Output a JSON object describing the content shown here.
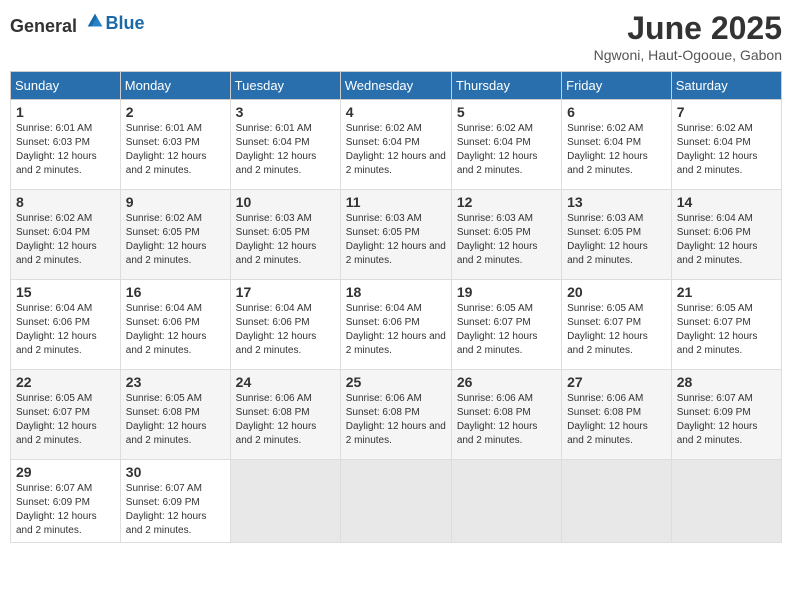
{
  "logo": {
    "general": "General",
    "blue": "Blue"
  },
  "title": "June 2025",
  "location": "Ngwoni, Haut-Ogooue, Gabon",
  "headers": [
    "Sunday",
    "Monday",
    "Tuesday",
    "Wednesday",
    "Thursday",
    "Friday",
    "Saturday"
  ],
  "weeks": [
    [
      {
        "day": "1",
        "sunrise": "6:01 AM",
        "sunset": "6:03 PM",
        "daylight": "12 hours and 2 minutes."
      },
      {
        "day": "2",
        "sunrise": "6:01 AM",
        "sunset": "6:03 PM",
        "daylight": "12 hours and 2 minutes."
      },
      {
        "day": "3",
        "sunrise": "6:01 AM",
        "sunset": "6:04 PM",
        "daylight": "12 hours and 2 minutes."
      },
      {
        "day": "4",
        "sunrise": "6:02 AM",
        "sunset": "6:04 PM",
        "daylight": "12 hours and 2 minutes."
      },
      {
        "day": "5",
        "sunrise": "6:02 AM",
        "sunset": "6:04 PM",
        "daylight": "12 hours and 2 minutes."
      },
      {
        "day": "6",
        "sunrise": "6:02 AM",
        "sunset": "6:04 PM",
        "daylight": "12 hours and 2 minutes."
      },
      {
        "day": "7",
        "sunrise": "6:02 AM",
        "sunset": "6:04 PM",
        "daylight": "12 hours and 2 minutes."
      }
    ],
    [
      {
        "day": "8",
        "sunrise": "6:02 AM",
        "sunset": "6:04 PM",
        "daylight": "12 hours and 2 minutes."
      },
      {
        "day": "9",
        "sunrise": "6:02 AM",
        "sunset": "6:05 PM",
        "daylight": "12 hours and 2 minutes."
      },
      {
        "day": "10",
        "sunrise": "6:03 AM",
        "sunset": "6:05 PM",
        "daylight": "12 hours and 2 minutes."
      },
      {
        "day": "11",
        "sunrise": "6:03 AM",
        "sunset": "6:05 PM",
        "daylight": "12 hours and 2 minutes."
      },
      {
        "day": "12",
        "sunrise": "6:03 AM",
        "sunset": "6:05 PM",
        "daylight": "12 hours and 2 minutes."
      },
      {
        "day": "13",
        "sunrise": "6:03 AM",
        "sunset": "6:05 PM",
        "daylight": "12 hours and 2 minutes."
      },
      {
        "day": "14",
        "sunrise": "6:04 AM",
        "sunset": "6:06 PM",
        "daylight": "12 hours and 2 minutes."
      }
    ],
    [
      {
        "day": "15",
        "sunrise": "6:04 AM",
        "sunset": "6:06 PM",
        "daylight": "12 hours and 2 minutes."
      },
      {
        "day": "16",
        "sunrise": "6:04 AM",
        "sunset": "6:06 PM",
        "daylight": "12 hours and 2 minutes."
      },
      {
        "day": "17",
        "sunrise": "6:04 AM",
        "sunset": "6:06 PM",
        "daylight": "12 hours and 2 minutes."
      },
      {
        "day": "18",
        "sunrise": "6:04 AM",
        "sunset": "6:06 PM",
        "daylight": "12 hours and 2 minutes."
      },
      {
        "day": "19",
        "sunrise": "6:05 AM",
        "sunset": "6:07 PM",
        "daylight": "12 hours and 2 minutes."
      },
      {
        "day": "20",
        "sunrise": "6:05 AM",
        "sunset": "6:07 PM",
        "daylight": "12 hours and 2 minutes."
      },
      {
        "day": "21",
        "sunrise": "6:05 AM",
        "sunset": "6:07 PM",
        "daylight": "12 hours and 2 minutes."
      }
    ],
    [
      {
        "day": "22",
        "sunrise": "6:05 AM",
        "sunset": "6:07 PM",
        "daylight": "12 hours and 2 minutes."
      },
      {
        "day": "23",
        "sunrise": "6:05 AM",
        "sunset": "6:08 PM",
        "daylight": "12 hours and 2 minutes."
      },
      {
        "day": "24",
        "sunrise": "6:06 AM",
        "sunset": "6:08 PM",
        "daylight": "12 hours and 2 minutes."
      },
      {
        "day": "25",
        "sunrise": "6:06 AM",
        "sunset": "6:08 PM",
        "daylight": "12 hours and 2 minutes."
      },
      {
        "day": "26",
        "sunrise": "6:06 AM",
        "sunset": "6:08 PM",
        "daylight": "12 hours and 2 minutes."
      },
      {
        "day": "27",
        "sunrise": "6:06 AM",
        "sunset": "6:08 PM",
        "daylight": "12 hours and 2 minutes."
      },
      {
        "day": "28",
        "sunrise": "6:07 AM",
        "sunset": "6:09 PM",
        "daylight": "12 hours and 2 minutes."
      }
    ],
    [
      {
        "day": "29",
        "sunrise": "6:07 AM",
        "sunset": "6:09 PM",
        "daylight": "12 hours and 2 minutes."
      },
      {
        "day": "30",
        "sunrise": "6:07 AM",
        "sunset": "6:09 PM",
        "daylight": "12 hours and 2 minutes."
      },
      null,
      null,
      null,
      null,
      null
    ]
  ],
  "labels": {
    "sunrise": "Sunrise:",
    "sunset": "Sunset:",
    "daylight": "Daylight:"
  }
}
